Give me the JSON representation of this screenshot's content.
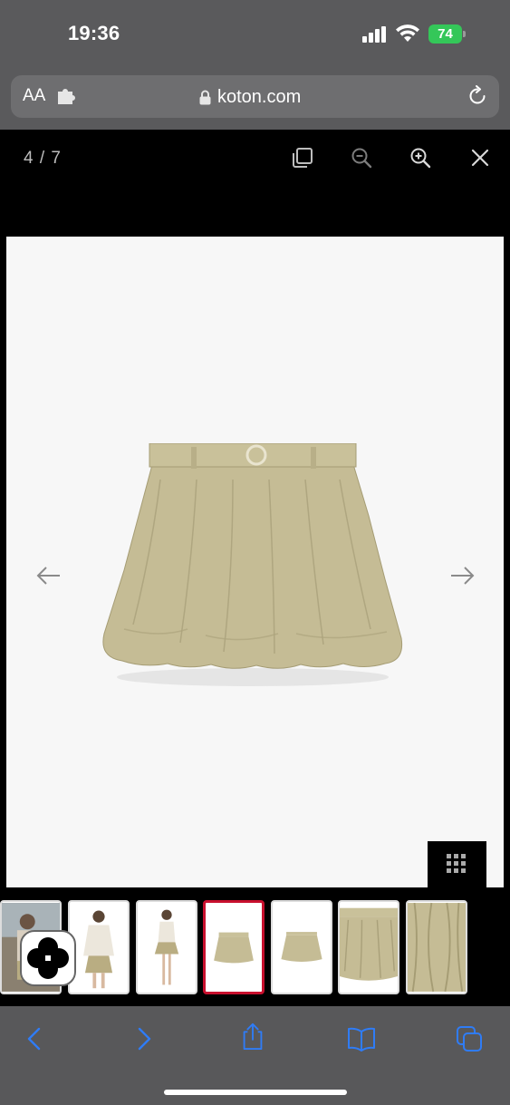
{
  "status_bar": {
    "time": "19:36",
    "battery": "74",
    "icons": [
      "signal-icon",
      "wifi-icon",
      "battery-icon"
    ]
  },
  "address_bar": {
    "reader_label": "AA",
    "url": "koton.com",
    "icons": [
      "puzzle-icon",
      "lock-icon",
      "reload-icon"
    ]
  },
  "viewer": {
    "counter": "4 / 7",
    "toolbar_icons": [
      "fullscreen-icon",
      "zoom-out-icon",
      "zoom-in-icon",
      "close-icon"
    ],
    "image_subject": "khaki bubble skirt with belt",
    "thumbnails_count": 7,
    "active_thumbnail": 4
  },
  "bottom_toolbar": {
    "icons": [
      "back-icon",
      "forward-icon",
      "share-icon",
      "bookmarks-icon",
      "tabs-icon"
    ]
  },
  "colors": {
    "accent_blue": "#2f7cf6",
    "active_red": "#c8102e",
    "skirt_khaki": "#c5bc95",
    "battery_green": "#34c759"
  }
}
